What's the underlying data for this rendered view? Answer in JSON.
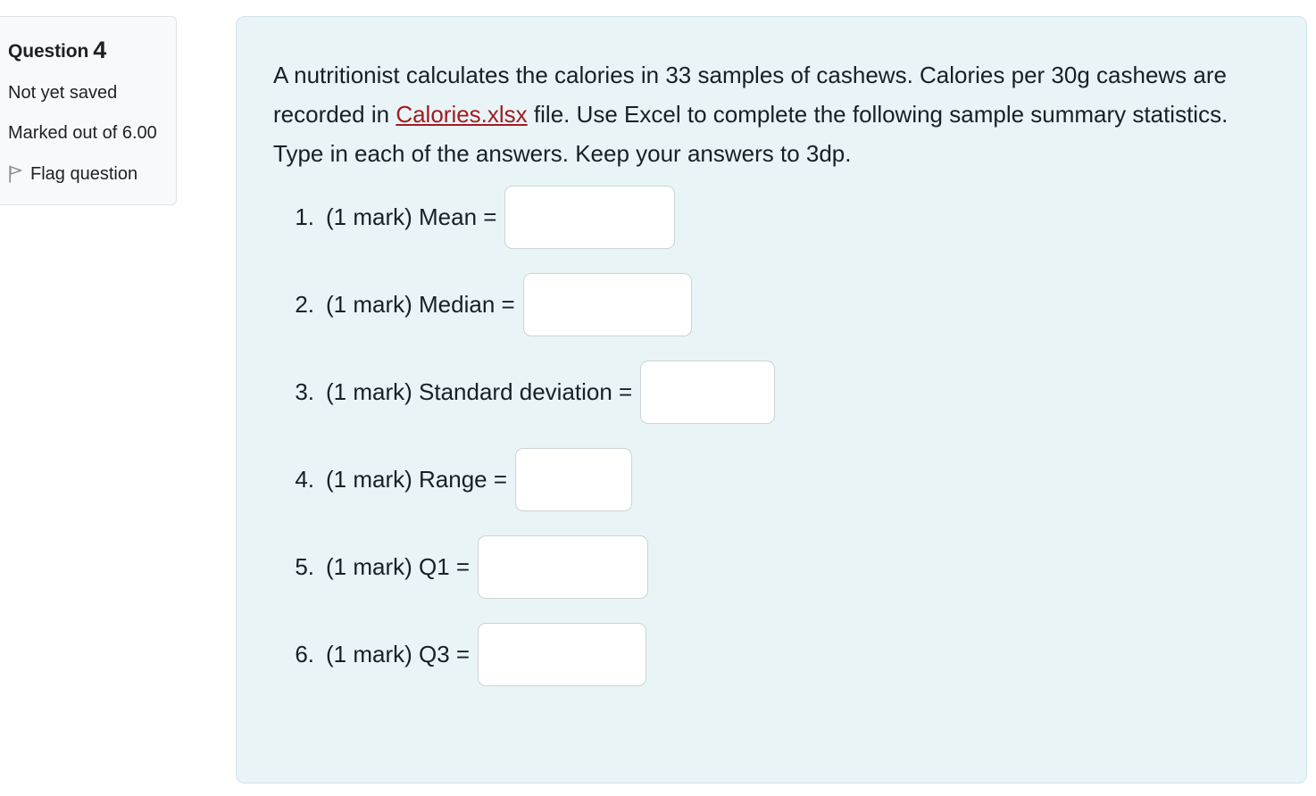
{
  "question_info": {
    "title_label": "Question",
    "question_number": "4",
    "save_status": "Not yet saved",
    "marks_line1": "Marked out of",
    "marks_line2": "6.00",
    "flag_label": "Flag question",
    "flag_icon": "flag-icon",
    "box_background": "#f8f9fa",
    "box_border": "#dee2e6"
  },
  "question": {
    "panel_background": "#e9f4f6",
    "panel_border": "#cfe3e9",
    "text_part1": "A nutritionist calculates the calories in 33 samples of cashews. Calories per 30g cashews are recorded in ",
    "file_link": "Calories.xlsx",
    "file_link_color": "#a21b22",
    "text_part2": " file. Use Excel to complete the following sample summary statistics. Type in each of the answers. Keep your answers to 3dp.",
    "answers": [
      {
        "marker": "1.",
        "label": "(1 mark) Mean =",
        "value": "",
        "placeholder": "",
        "input_name": "mean-input",
        "width_class": "w-191"
      },
      {
        "marker": "2.",
        "label": "(1 mark) Median =",
        "value": "",
        "placeholder": "",
        "input_name": "median-input",
        "width_class": "w-189"
      },
      {
        "marker": "3.",
        "label": "(1 mark) Standard deviation =",
        "value": "",
        "placeholder": "",
        "input_name": "standard-deviation-input",
        "width_class": "w-151"
      },
      {
        "marker": "4.",
        "label": "(1 mark) Range =",
        "value": "",
        "placeholder": "",
        "input_name": "range-input",
        "width_class": "w-131"
      },
      {
        "marker": "5.",
        "label": "(1 mark) Q1 =",
        "value": "",
        "placeholder": "",
        "input_name": "q1-input",
        "width_class": "w-191"
      },
      {
        "marker": "6.",
        "label": "(1 mark) Q3 =",
        "value": "",
        "placeholder": "",
        "input_name": "q3-input",
        "width_class": "w-189"
      }
    ]
  }
}
